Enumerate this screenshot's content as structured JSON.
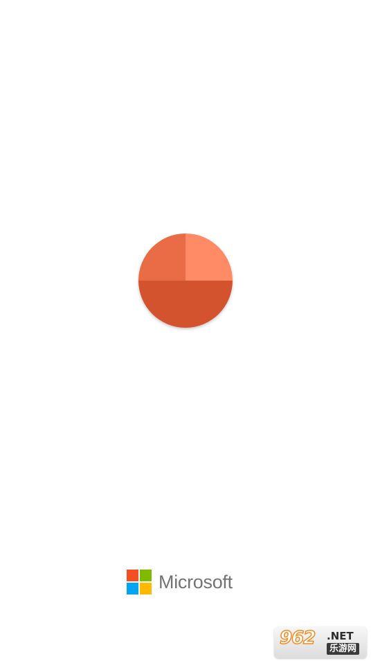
{
  "splash": {
    "app_logo_icon": "powerpoint-pie-logo-icon",
    "colors": {
      "background": "#ffffff",
      "logo_top_left": "#ea6c46",
      "logo_top_right": "#ff8a66",
      "logo_bottom": "#d3522f"
    }
  },
  "brand": {
    "logo_icon": "microsoft-logo-icon",
    "wordmark": "Microsoft",
    "colors": {
      "red": "#f25022",
      "green": "#7fba00",
      "blue": "#00a4ef",
      "yellow": "#ffb900",
      "text": "#737373"
    }
  },
  "watermark": {
    "digits": "962",
    "suffix": ".NET",
    "cn_text": "乐游网"
  }
}
